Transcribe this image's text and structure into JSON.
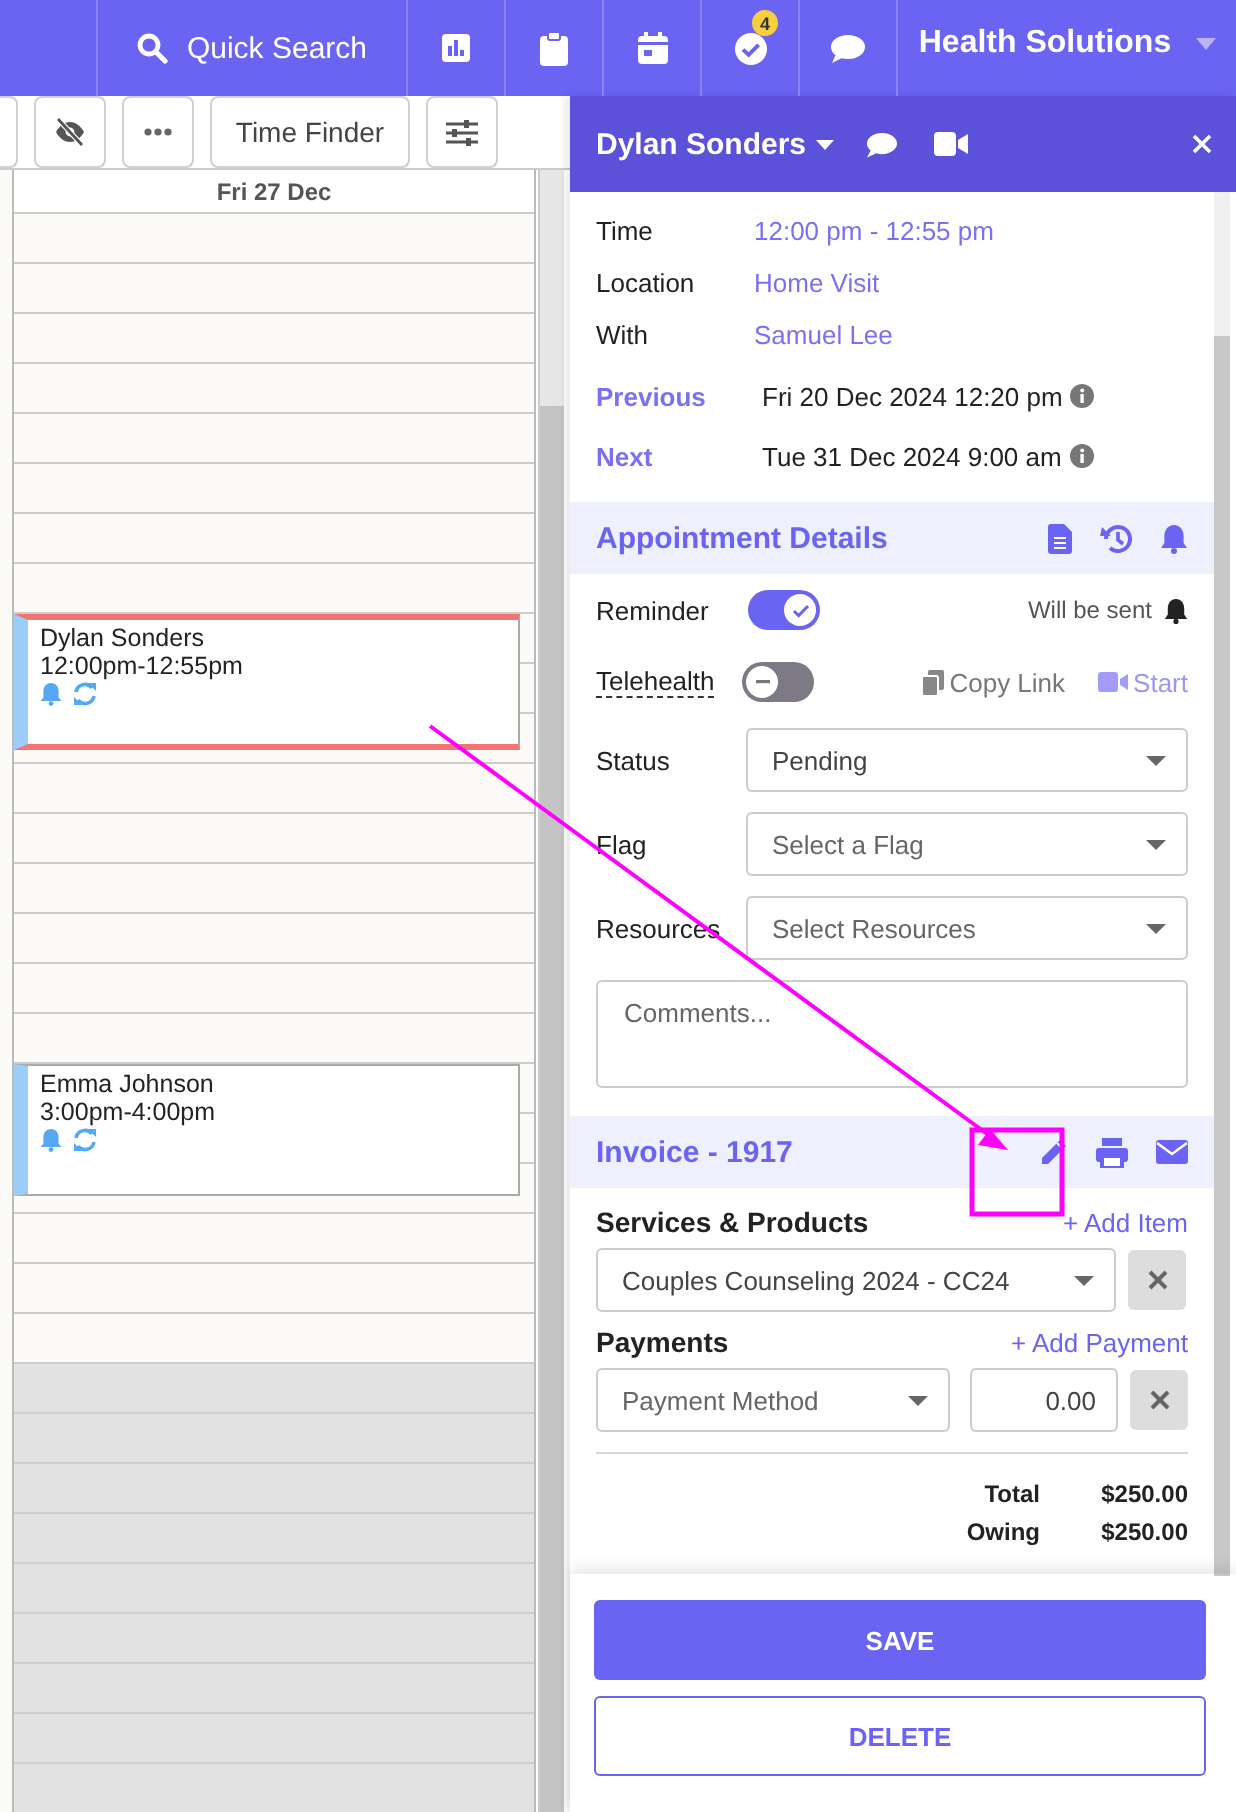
{
  "topbar": {
    "search_label": "Quick Search",
    "badge": "4",
    "org_name": "Health Solutions"
  },
  "toolbar": {
    "time_finder": "Time Finder"
  },
  "calendar": {
    "day_header": "Fri 27 Dec",
    "appointments": [
      {
        "name": "Dylan Sonders",
        "time": "12:00pm-12:55pm",
        "selected": true
      },
      {
        "name": "Emma Johnson",
        "time": "3:00pm-4:00pm",
        "selected": false
      }
    ]
  },
  "panel": {
    "client_name": "Dylan Sonders",
    "details": [
      {
        "label": "Time",
        "value": "12:00 pm - 12:55 pm"
      },
      {
        "label": "Location",
        "value": "Home Visit"
      },
      {
        "label": "With",
        "value": "Samuel Lee"
      }
    ],
    "history": [
      {
        "label": "Previous",
        "value": "Fri 20 Dec 2024 12:20 pm"
      },
      {
        "label": "Next",
        "value": "Tue 31 Dec 2024 9:00 am"
      }
    ],
    "section_title": "Appointment Details",
    "reminder": {
      "label": "Reminder",
      "on": true,
      "note": "Will be sent"
    },
    "telehealth": {
      "label": "Telehealth",
      "on": false,
      "copy_link": "Copy Link",
      "start": "Start"
    },
    "selects": [
      {
        "label": "Status",
        "value": "Pending"
      },
      {
        "label": "Flag",
        "placeholder": "Select a Flag"
      },
      {
        "label": "Resources",
        "placeholder": "Select Resources"
      }
    ],
    "comments": {
      "placeholder": "Comments..."
    },
    "invoice": {
      "title": "Invoice - 1917",
      "services_label": "Services & Products",
      "add_item": "+ Add Item",
      "service": "Couples Counseling 2024 - CC24",
      "payments_label": "Payments",
      "add_payment": "+ Add Payment",
      "payment_method": {
        "placeholder": "Payment Method"
      },
      "amount": "0.00",
      "totals": [
        {
          "label": "Total",
          "value": "$250.00"
        },
        {
          "label": "Owing",
          "value": "$250.00"
        }
      ]
    },
    "buttons": {
      "save": "SAVE",
      "delete": "DELETE"
    }
  }
}
